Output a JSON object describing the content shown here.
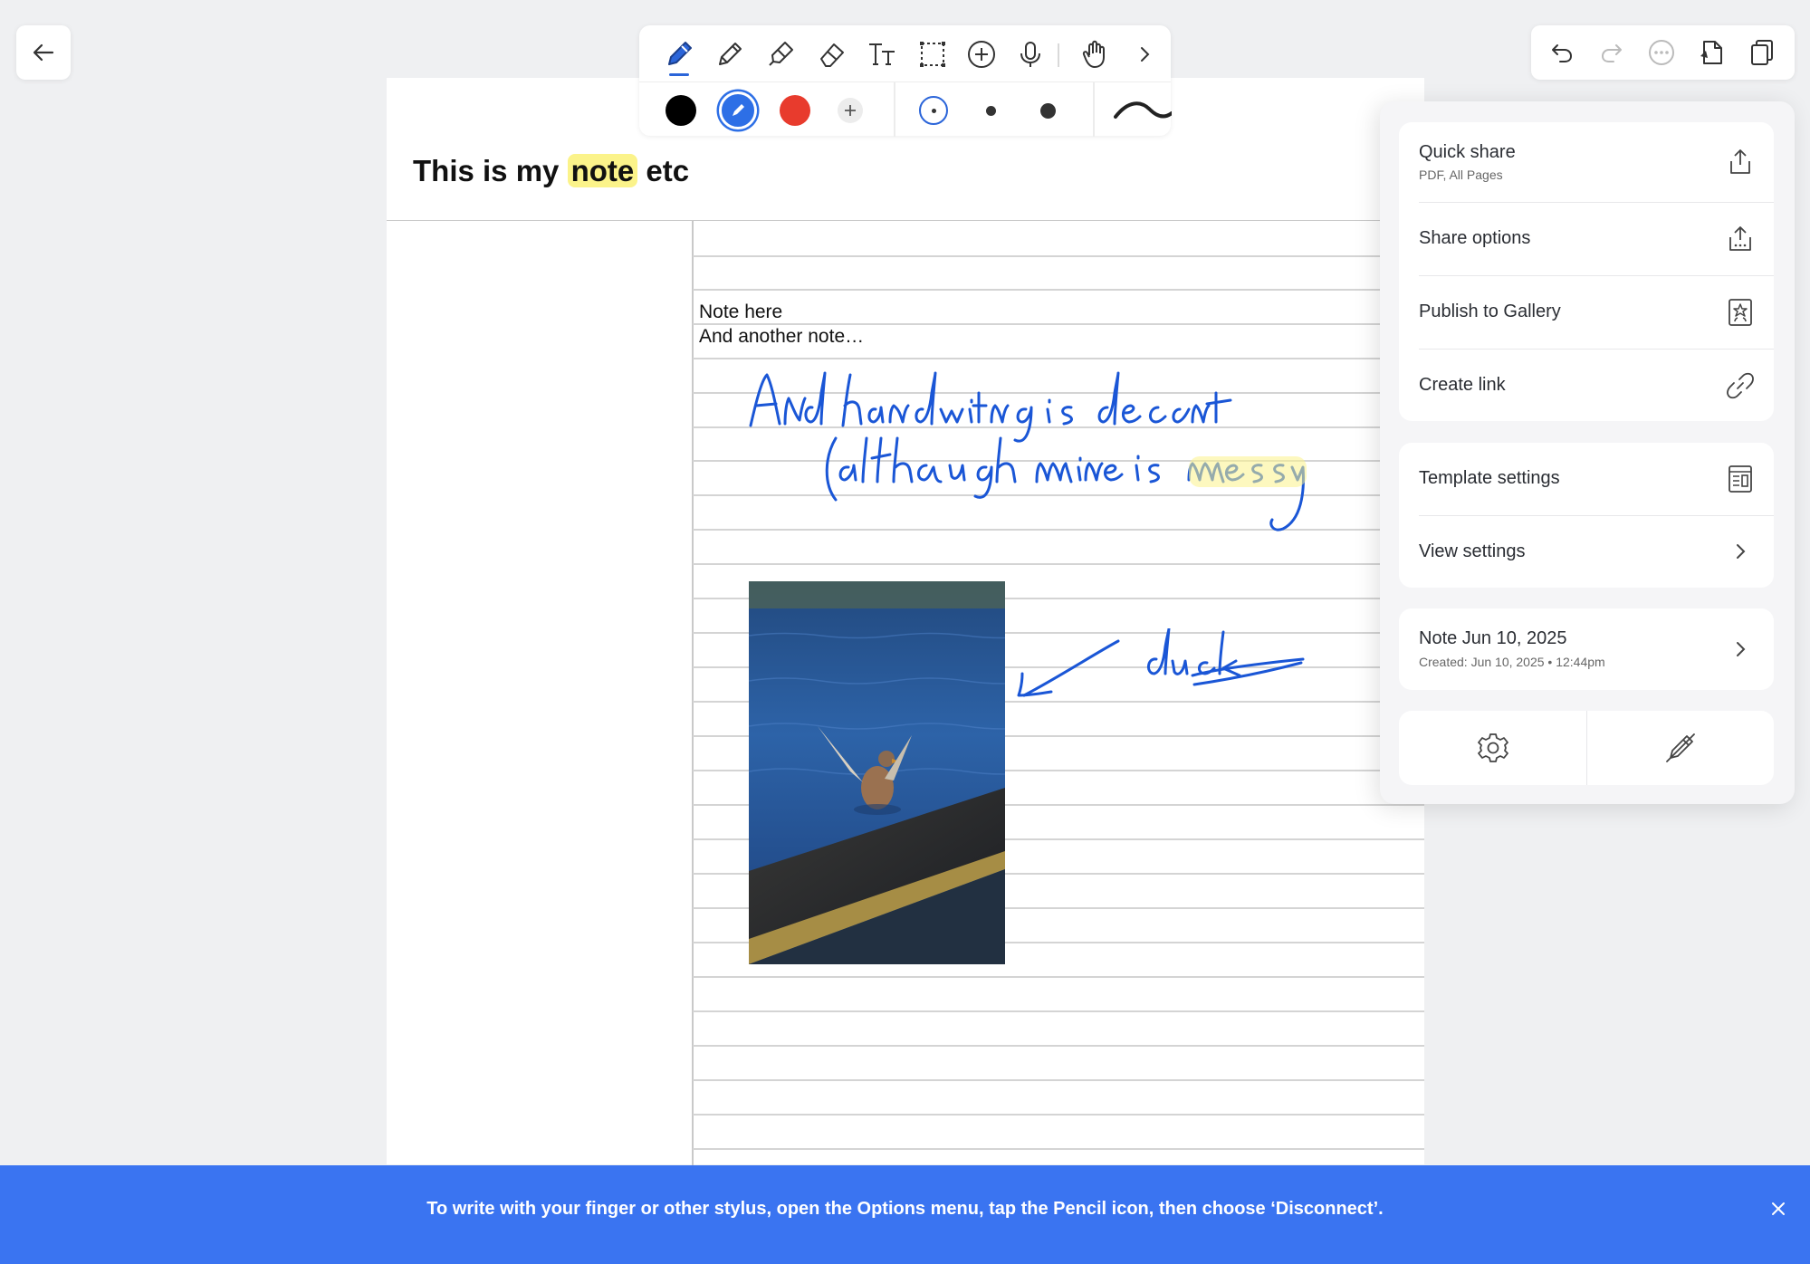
{
  "note": {
    "title_before": "This is my",
    "title_highlight": "note",
    "title_after": "etc",
    "text_lines": [
      "Note here",
      "And another note…"
    ]
  },
  "menu": {
    "quick_share": {
      "label": "Quick share",
      "sub": "PDF, All Pages"
    },
    "share_options": "Share options",
    "publish_gallery": "Publish to Gallery",
    "create_link": "Create link",
    "template_settings": "Template settings",
    "view_settings": "View settings",
    "note_info": {
      "title": "Note Jun 10, 2025",
      "created": "Created: Jun 10, 2025 • 12:44pm"
    }
  },
  "banner": {
    "message": "To write with your finger or other stylus, open the Options menu, tap the Pencil icon, then choose ‘Disconnect’."
  },
  "colors": {
    "accent": "#2b65d9",
    "ink_blue": "#1a56d6",
    "highlight": "#fbf38a",
    "pen_black": "#000000",
    "pen_blue": "#2d6fe6",
    "pen_red": "#e83b2d",
    "banner": "#3a74f1"
  },
  "icons": {
    "toolbar": [
      "pen-icon",
      "pencil-icon",
      "highlighter-icon",
      "eraser-icon",
      "text-icon",
      "lasso-select-icon",
      "add-icon",
      "microphone-icon",
      "hand-icon",
      "chevron-right-icon"
    ],
    "actions": [
      "undo-icon",
      "redo-icon",
      "more-icon",
      "export-icon",
      "pages-icon"
    ]
  }
}
